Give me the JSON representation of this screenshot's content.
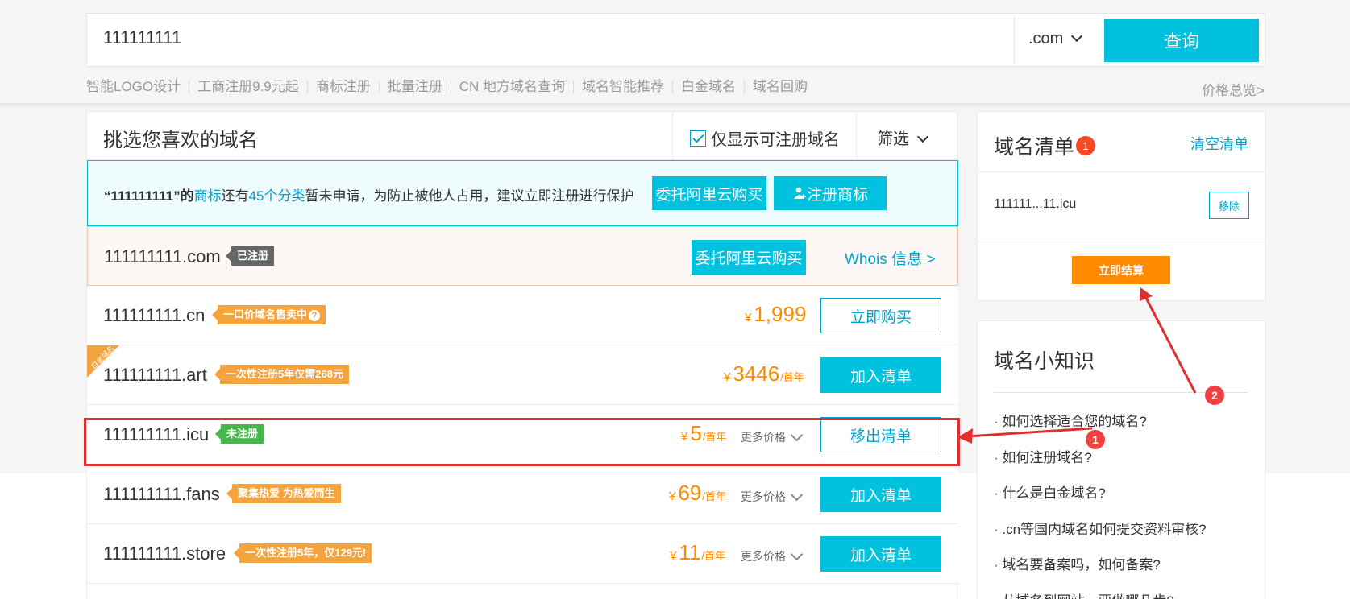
{
  "search": {
    "query": "111111111",
    "tld": ".com",
    "button_label": "查询"
  },
  "quick_links": [
    "智能LOGO设计",
    "工商注册9.9元起",
    "商标注册",
    "批量注册",
    "CN 地方域名查询",
    "域名智能推荐",
    "白金域名",
    "域名回购"
  ],
  "price_overview": "价格总览>",
  "panel": {
    "title": "挑选您喜欢的域名",
    "only_available_label": "仅显示可注册域名",
    "filter_label": "筛选"
  },
  "notice": {
    "quote_open": "“",
    "name": "111111111",
    "quote_close": "”的",
    "trademark": "商标",
    "mid": "还有",
    "count": "45个分类",
    "tail": "暂未申请，为防止被他人占用，建议立即注册进行保护",
    "delegate_label": "委托阿里云购买",
    "register_tm_label": "注册商标"
  },
  "rows": [
    {
      "domain": "111111111.com",
      "tag": "已注册",
      "action": "委托阿里云购买",
      "whois": "Whois 信息 >"
    },
    {
      "domain": "111111111.cn",
      "tag": "一口价域名售卖中",
      "currency": "¥",
      "price": "1,999",
      "action": "立即购买"
    },
    {
      "domain": "111111111.art",
      "tag": "一次性注册5年仅需268元",
      "corner": "白金域名",
      "currency": "¥",
      "price": "3446",
      "unit": "/首年",
      "action": "加入清单"
    },
    {
      "domain": "111111111.icu",
      "tag": "未注册",
      "currency": "¥",
      "price": "5",
      "unit": "/首年",
      "more": "更多价格",
      "action": "移出清单"
    },
    {
      "domain": "111111111.fans",
      "tag": "聚集热爱 为热爱而生",
      "currency": "¥",
      "price": "69",
      "unit": "/首年",
      "more": "更多价格",
      "action": "加入清单"
    },
    {
      "domain": "111111111.store",
      "tag": "一次性注册5年，仅129元!",
      "currency": "¥",
      "price": "11",
      "unit": "/首年",
      "more": "更多价格",
      "action": "加入清单"
    }
  ],
  "cart": {
    "title": "域名清单",
    "count": "1",
    "clear_label": "清空清单",
    "item": "111111...11.icu",
    "remove_label": "移除",
    "checkout_label": "立即结算"
  },
  "knowledge": {
    "title": "域名小知识",
    "items": [
      "如何选择适合您的域名?",
      "如何注册域名?",
      "什么是白金域名?",
      ".cn等国内域名如何提交资料审核?",
      "域名要备案吗，如何备案?",
      "从域名到网站，要做哪几步?"
    ]
  },
  "annotations": {
    "marker_1": "1",
    "marker_2": "2"
  },
  "colors": {
    "accent": "#00c1de",
    "link": "#00a2ca",
    "price": "#ff8a00",
    "annotation": "#e02f2f"
  }
}
